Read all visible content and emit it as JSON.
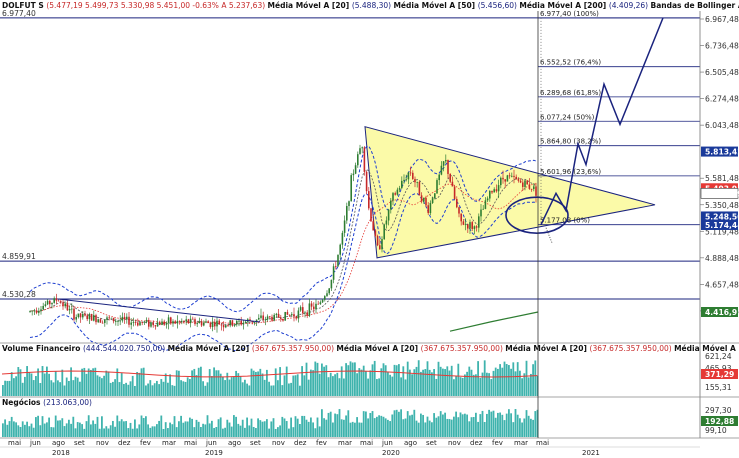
{
  "header": {
    "main": {
      "symbol": "DOLFUT S",
      "quote": "(5.477,19  5.499,73  5.330,98  5.451,00  -0.63%  A 5.237,63)",
      "ma1": "Média Móvel A [20]",
      "ma1_val": "(5.488,30)",
      "ma2": "Média Móvel A [50]",
      "ma2_val": "(5.456,60)",
      "ma3": "Média Móvel A [200]",
      "ma3_val": "(4.409,26)",
      "bb": "Bandas de Bollinger A [20]",
      "bb_val": "(5.82"
    },
    "volume": {
      "label": "Volume Financeiro",
      "val": "(444.544.020.750,00)",
      "ma_label": "Média Móvel A [20]",
      "ma_val": "(367.675.357.950,00)",
      "ma_val_cut": "(367.675."
    },
    "trades": {
      "label": "Negócios",
      "val": "(213.063,00)"
    }
  },
  "colors": {
    "up": "#2e7d32",
    "down": "#c62828",
    "triangle_fill": "#fbfaa8",
    "navy": "#1a237e",
    "teal": "#3fb3ad",
    "tag_blue": "#1a3a9a",
    "tag_red": "#e53935",
    "tag_green": "#2e7d32"
  },
  "price_axis": {
    "ticks": [
      "6.967,48",
      "6.736,48",
      "6.505,48",
      "6.274,48",
      "6.043,48",
      "5.581,48",
      "5.350,48",
      "5.119,48",
      "4.888,48",
      "4.657,48",
      "4.426,48"
    ],
    "tags": [
      {
        "label": "5.813,42",
        "color": "#1a3a9a"
      },
      {
        "label": "5.493,93",
        "color": "#e53935"
      },
      {
        "label": "5.449,59",
        "color": "#ffffff"
      },
      {
        "label": "5.248,50",
        "color": "#1a3a9a"
      },
      {
        "label": "5.174,44",
        "color": "#1a3a9a"
      },
      {
        "label": "4.416,91",
        "color": "#2e7d32"
      }
    ]
  },
  "volume_axis": {
    "ticks": [
      "621,24",
      "465,93",
      "155,31"
    ],
    "tag": "371,29"
  },
  "trades_axis": {
    "ticks": [
      "297,30",
      "99,10"
    ],
    "tag": "192,88"
  },
  "left_labels": [
    "6.977,40",
    "4.859,91",
    "4.530,28"
  ],
  "fibo_labels": [
    "6.977,40 (100%)",
    "6.552,52 (76,4%)",
    "6.289,68 (61,8%)",
    "6.077,24 (50%)",
    "5.864,80 (38,2%)",
    "5.601,96 (23,6%)",
    "5.177,08 (0%)"
  ],
  "months": [
    "mai",
    "jun",
    "ago",
    "set",
    "nov",
    "dez",
    "fev",
    "mar",
    "mai",
    "jun",
    "ago",
    "set",
    "nov",
    "dez",
    "fev",
    "mar",
    "mai",
    "jun",
    "ago",
    "set",
    "nov",
    "dez",
    "fev",
    "mar",
    "mai"
  ],
  "years": [
    "2018",
    "2019",
    "2020",
    "2021"
  ],
  "chart_data": {
    "type": "candlestick",
    "instrument": "DOLFUT S",
    "last_bar": {
      "open": 5477.19,
      "high": 5499.73,
      "low": 5330.98,
      "close": 5451.0,
      "change_pct": -0.63
    },
    "indicators": {
      "ma20": 5488.3,
      "ma50": 5456.6,
      "ma200": 4409.26
    },
    "price_range": [
      4350,
      7000
    ],
    "fibonacci": [
      {
        "level": 6977.4,
        "pct": "100%"
      },
      {
        "level": 6552.52,
        "pct": "76,4%"
      },
      {
        "level": 6289.68,
        "pct": "61,8%"
      },
      {
        "level": 6077.24,
        "pct": "50%"
      },
      {
        "level": 5864.8,
        "pct": "38,2%"
      },
      {
        "level": 5601.96,
        "pct": "23,6%"
      },
      {
        "level": 5177.08,
        "pct": "0%"
      }
    ],
    "horizontal_levels": [
      6977.4,
      4859.91,
      4530.28
    ],
    "pattern": "symmetrical triangle",
    "forecast_path": [
      5177,
      5450,
      5300,
      5880,
      5700,
      6400,
      6050,
      6977
    ],
    "volume_panel": {
      "ticks": [
        621.24,
        465.93,
        155.31
      ],
      "last": 371.29
    },
    "trades_panel": {
      "ticks": [
        297.3,
        99.1
      ],
      "last": 192.88
    }
  }
}
